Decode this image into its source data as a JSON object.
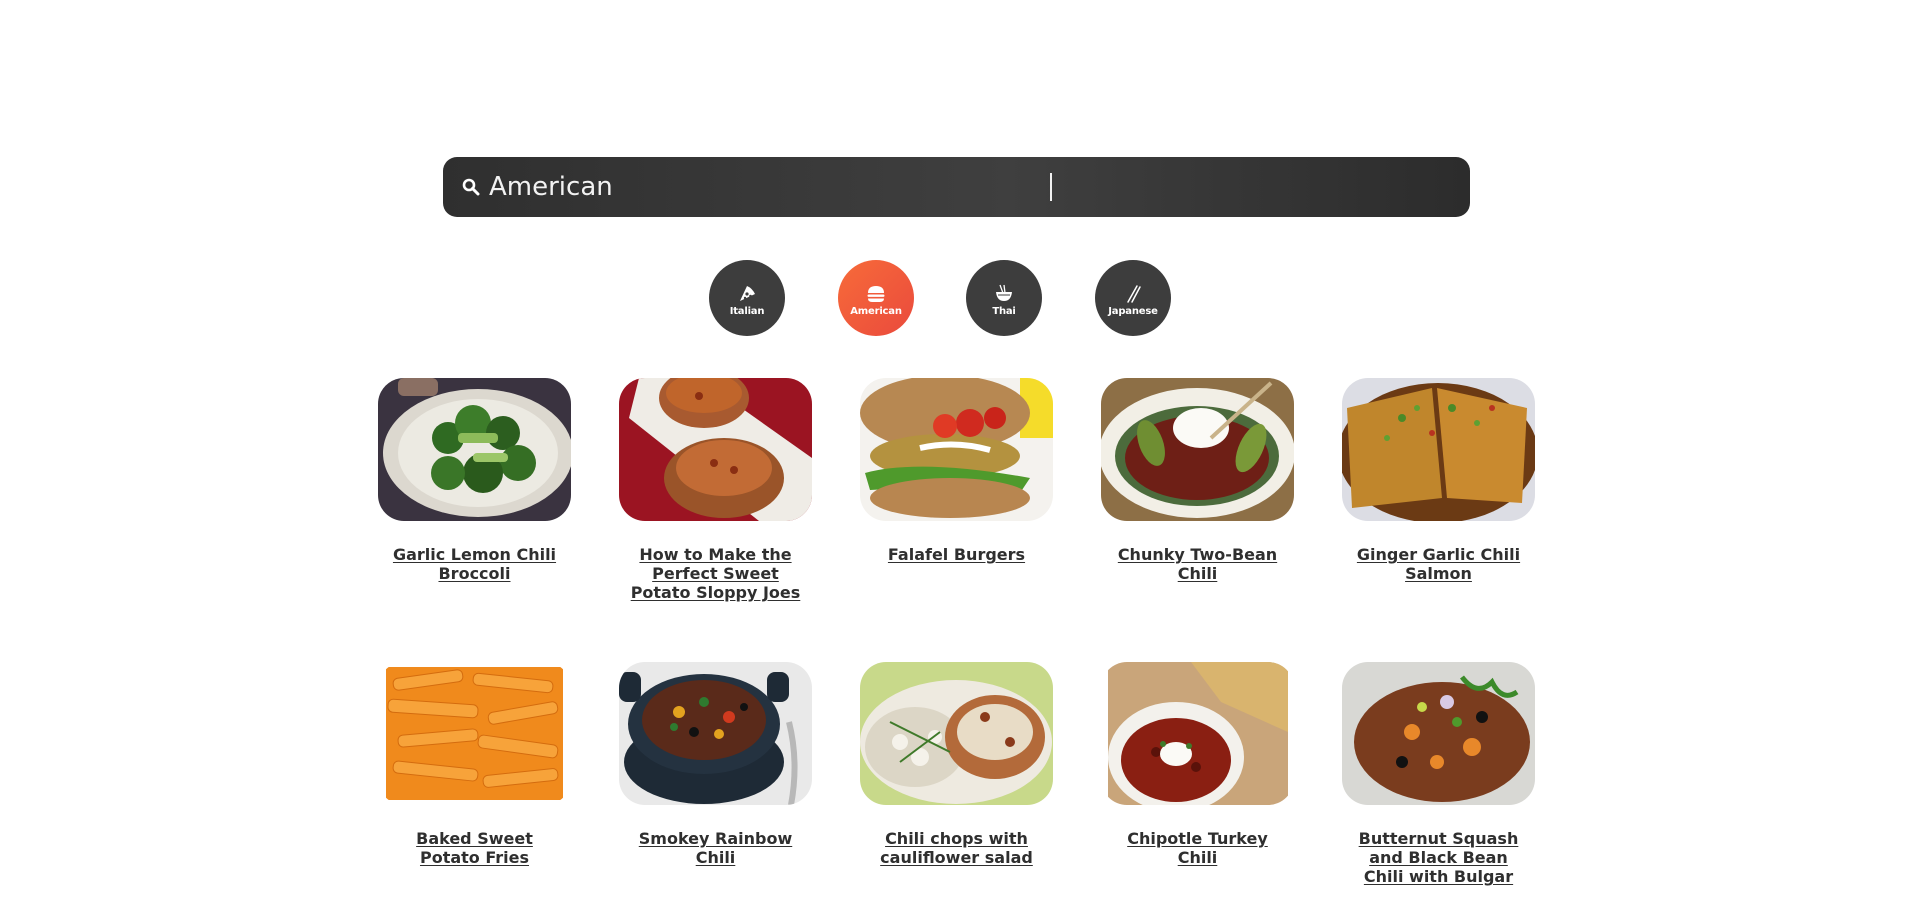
{
  "search": {
    "value": "American",
    "icon": "search-icon"
  },
  "categories": [
    {
      "label": "Italian",
      "icon": "pizza-icon",
      "active": false
    },
    {
      "label": "American",
      "icon": "burger-icon",
      "active": true
    },
    {
      "label": "Thai",
      "icon": "noodle-bowl-icon",
      "active": false
    },
    {
      "label": "Japanese",
      "icon": "chopsticks-icon",
      "active": false
    }
  ],
  "recipes": [
    {
      "title": "Garlic Lemon Chili Broccoli",
      "image": "broccoli-photo"
    },
    {
      "title": "How to Make the Perfect Sweet Potato Sloppy Joes",
      "image": "sweet-potato-sloppy-joes-photo"
    },
    {
      "title": "Falafel Burgers",
      "image": "falafel-burger-photo"
    },
    {
      "title": "Chunky Two-Bean Chili",
      "image": "two-bean-chili-photo"
    },
    {
      "title": "Ginger Garlic Chili Salmon",
      "image": "chili-salmon-photo"
    },
    {
      "title": "Baked Sweet Potato Fries",
      "image": "sweet-potato-fries-photo"
    },
    {
      "title": "Smokey Rainbow Chili",
      "image": "rainbow-chili-photo"
    },
    {
      "title": "Chili chops with cauliflower salad",
      "image": "chili-chops-photo"
    },
    {
      "title": "Chipotle Turkey Chili",
      "image": "turkey-chili-photo"
    },
    {
      "title": "Butternut Squash and Black Bean Chili with Bulgar",
      "image": "butternut-chili-photo"
    }
  ],
  "colors": {
    "accent": "#ef5a3b",
    "dark": "#3d3d3d",
    "title_text": "#2f2f2f"
  }
}
